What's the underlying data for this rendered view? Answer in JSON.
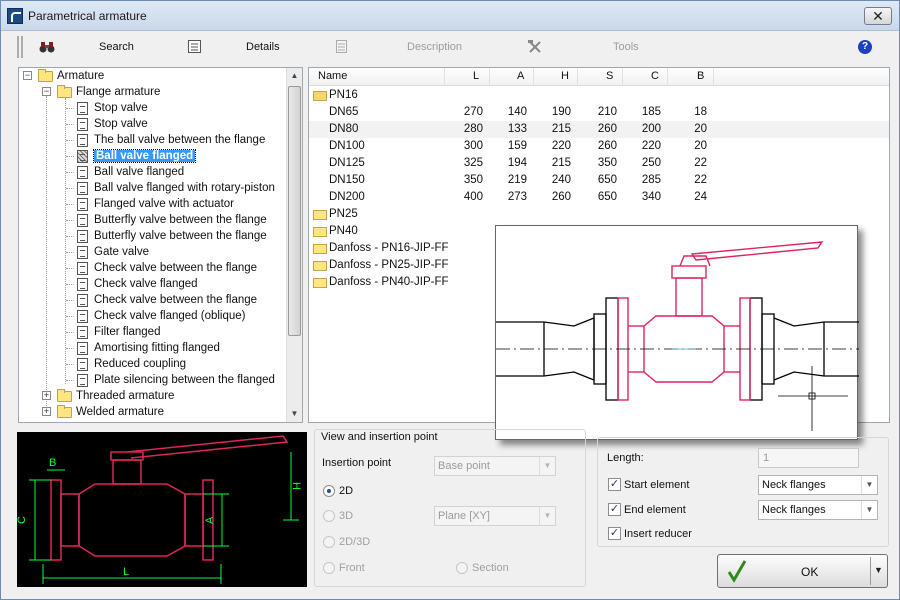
{
  "window": {
    "title": "Parametrical armature"
  },
  "toolbar": {
    "search_label": "Search",
    "details_label": "Details",
    "description_label": "Description",
    "tools_label": "Tools",
    "help_label": "?"
  },
  "tree": {
    "root": "Armature",
    "group": "Flange armature",
    "items": [
      "Stop valve",
      "Stop valve",
      "The ball valve between the flange",
      "Ball valve flanged",
      "Ball valve flanged",
      "Ball valve flanged with rotary-piston",
      "Flanged valve with actuator",
      "Butterfly valve between the flange",
      "Butterfly valve between the flange",
      "Gate valve",
      "Check valve between the flange",
      "Check valve flanged",
      "Check valve between the flange",
      "Check valve flanged (oblique)",
      "Filter flanged",
      "Amortising fitting flanged",
      "Reduced coupling",
      "Plate silencing between the flanged"
    ],
    "selected_index": 3,
    "other_groups": [
      "Threaded armature",
      "Welded armature"
    ]
  },
  "table": {
    "columns": [
      "Name",
      "L",
      "A",
      "H",
      "S",
      "C",
      "B"
    ],
    "open_folder": "PN16",
    "rows": [
      {
        "name": "DN65",
        "L": "270",
        "A": "140",
        "H": "190",
        "S": "210",
        "C": "185",
        "B": "18"
      },
      {
        "name": "DN80",
        "L": "280",
        "A": "133",
        "H": "215",
        "S": "260",
        "C": "200",
        "B": "20"
      },
      {
        "name": "DN100",
        "L": "300",
        "A": "159",
        "H": "220",
        "S": "260",
        "C": "220",
        "B": "20"
      },
      {
        "name": "DN125",
        "L": "325",
        "A": "194",
        "H": "215",
        "S": "350",
        "C": "250",
        "B": "22"
      },
      {
        "name": "DN150",
        "L": "350",
        "A": "219",
        "H": "240",
        "S": "650",
        "C": "285",
        "B": "22"
      },
      {
        "name": "DN200",
        "L": "400",
        "A": "273",
        "H": "260",
        "S": "650",
        "C": "340",
        "B": "24"
      }
    ],
    "folders": [
      "PN25",
      "PN40",
      "Danfoss - PN16-JIP-FF",
      "Danfoss - PN25-JIP-FF",
      "Danfoss - PN40-JIP-FF"
    ]
  },
  "dimension_labels": {
    "B": "B",
    "H": "H",
    "C": "C",
    "A": "A",
    "L": "L"
  },
  "view_group": {
    "title": "View and insertion point",
    "insertion_label": "Insertion point",
    "insertion_value": "Base point",
    "options": [
      "2D",
      "3D",
      "2D/3D",
      "Front",
      "Section"
    ],
    "plane_value": "Plane  [XY]"
  },
  "element_group": {
    "length_label": "Length:",
    "length_value": "1",
    "start_label": "Start element",
    "start_value": "Neck flanges",
    "end_label": "End element",
    "end_value": "Neck flanges",
    "reducer_label": "Insert reducer"
  },
  "ok_label": "OK",
  "colors": {
    "accent": "#3399ff",
    "drawing_red": "#e0245e",
    "dimension_green": "#00ff33"
  }
}
